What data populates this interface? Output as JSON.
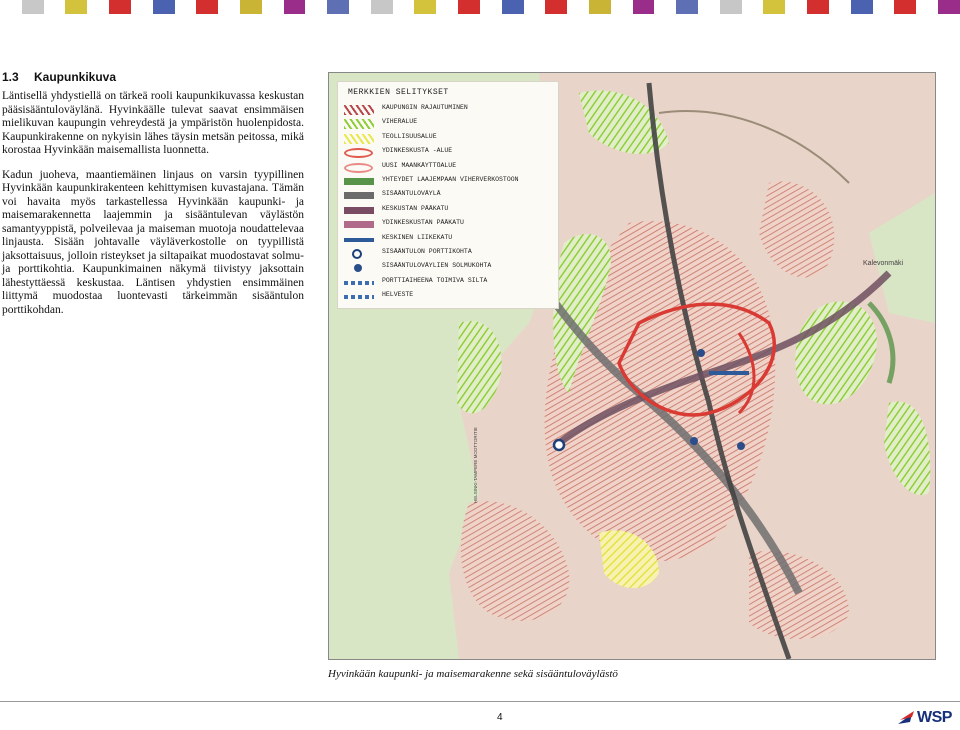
{
  "header_stripe_colors": [
    "#ffffff",
    "#c8c8c8",
    "#ffffff",
    "#d2c23c",
    "#ffffff",
    "#d32f2f",
    "#ffffff",
    "#4b62b0",
    "#ffffff",
    "#d32f2f",
    "#ffffff",
    "#c9b436",
    "#ffffff",
    "#9a2d8a",
    "#ffffff",
    "#5f6fb4",
    "#ffffff",
    "#c7c7c7",
    "#ffffff",
    "#d2c23c",
    "#ffffff",
    "#d32f2f",
    "#ffffff",
    "#4b62b0",
    "#ffffff",
    "#d32f2f",
    "#ffffff",
    "#c9b436",
    "#ffffff",
    "#9a2d8a",
    "#ffffff",
    "#5f6fb4",
    "#ffffff",
    "#c7c7c7",
    "#ffffff",
    "#d2c23c",
    "#ffffff",
    "#d32f2f",
    "#ffffff",
    "#4b62b0",
    "#ffffff",
    "#d32f2f",
    "#ffffff",
    "#9a2d8a"
  ],
  "section": {
    "number": "1.3",
    "title": "Kaupunkikuva",
    "paragraphs": [
      "Läntisellä yhdystiellä on tärkeä rooli kaupunkikuvassa keskustan pääsisääntuloväylänä. Hyvinkäälle tulevat saavat ensimmäisen mielikuvan kaupungin vehreydestä ja ympäristön huolenpidosta. Kaupunkirakenne on nykyisin lähes täysin metsän peitossa, mikä korostaa Hyvinkään maisemallista luonnetta.",
      "Kadun juoheva, maantiemäinen linjaus on varsin tyypillinen Hyvinkään kaupunkirakenteen kehittymisen kuvastajana. Tämän voi havaita myös tarkastellessa Hyvinkään kaupunki- ja maisemarakennetta laajemmin ja sisääntulevan väylästön samantyyppistä, polveilevaa ja maiseman muotoja noudattelevaa linjausta. Sisään johtavalle väyläverkostolle on tyypillistä jaksottaisuus, jolloin risteykset ja siltapaikat muodostavat solmu- ja porttikohtia. Kaupunkimainen näkymä tiivistyy jaksottain lähestyttäessä keskustaa. Läntisen yhdystien ensimmäinen liittymä muodostaa luontevasti tärkeimmän sisääntulon porttikohdan."
    ]
  },
  "legend": {
    "title": "MERKKIEN SELITYKSET",
    "items": [
      {
        "label": "KAUPUNGIN RAJAUTUMINEN",
        "color": "#b8474c",
        "icon": "red-hatch-swatch"
      },
      {
        "label": "VIHERALUE",
        "color": "#8fce3a",
        "icon": "green-hatch-swatch"
      },
      {
        "label": "TEOLLISUUSALUE",
        "color": "#e9e84a",
        "icon": "yellow-hatch-swatch"
      },
      {
        "label": "YDINKESKUSTA -ALUE",
        "color": "#e05a4e",
        "icon": "red-ellipse-swatch"
      },
      {
        "label": "UUSI MAANKÄYTTÖALUE",
        "color": "#e98a86",
        "icon": "pink-ellipse-swatch"
      },
      {
        "label": "YHTEYDET LAAJEMPAAN VIHERVERKOSTOON",
        "color": "#58934a",
        "icon": "green-band-swatch"
      },
      {
        "label": "SISÄÄNTULOVÄYLÄ",
        "color": "#6b6b6b",
        "icon": "grey-band-swatch"
      },
      {
        "label": "KESKUSTAN PÄÄKATU",
        "color": "#7a4c63",
        "icon": "purple-band-swatch"
      },
      {
        "label": "YDINKESKUSTAN PÄÄKATU",
        "color": "#b06b8a",
        "icon": "mauve-band-swatch"
      },
      {
        "label": "KESKINEN LIIKEKATU",
        "color": "#2f5a9a",
        "icon": "blue-bar-swatch"
      },
      {
        "label": "SISÄÄNTULON PORTTIKOHTA",
        "color": "#1d3f7a",
        "icon": "target-marker"
      },
      {
        "label": "SISÄÄNTULOVÄYLIEN SOLMUKOHTA",
        "color": "#2b4d8a",
        "icon": "dot-marker"
      },
      {
        "label": "PORTTIAIHEENA TOIMIVA SILTA",
        "color": "#3c6db0",
        "icon": "dashed-blue-swatch"
      },
      {
        "label": "HELVESTE",
        "color": "#3c6db0",
        "icon": "dashed-blue-swatch"
      }
    ]
  },
  "map_labels": {
    "kalevonmaki": "Kalevonmäki",
    "rail": "HELSINKI-TAMPERE MOOTTORITIE"
  },
  "caption": "Hyvinkään kaupunki- ja maisemarakenne sekä sisääntuloväylästö",
  "footer": {
    "page_number": "4",
    "logo": "WSP"
  }
}
